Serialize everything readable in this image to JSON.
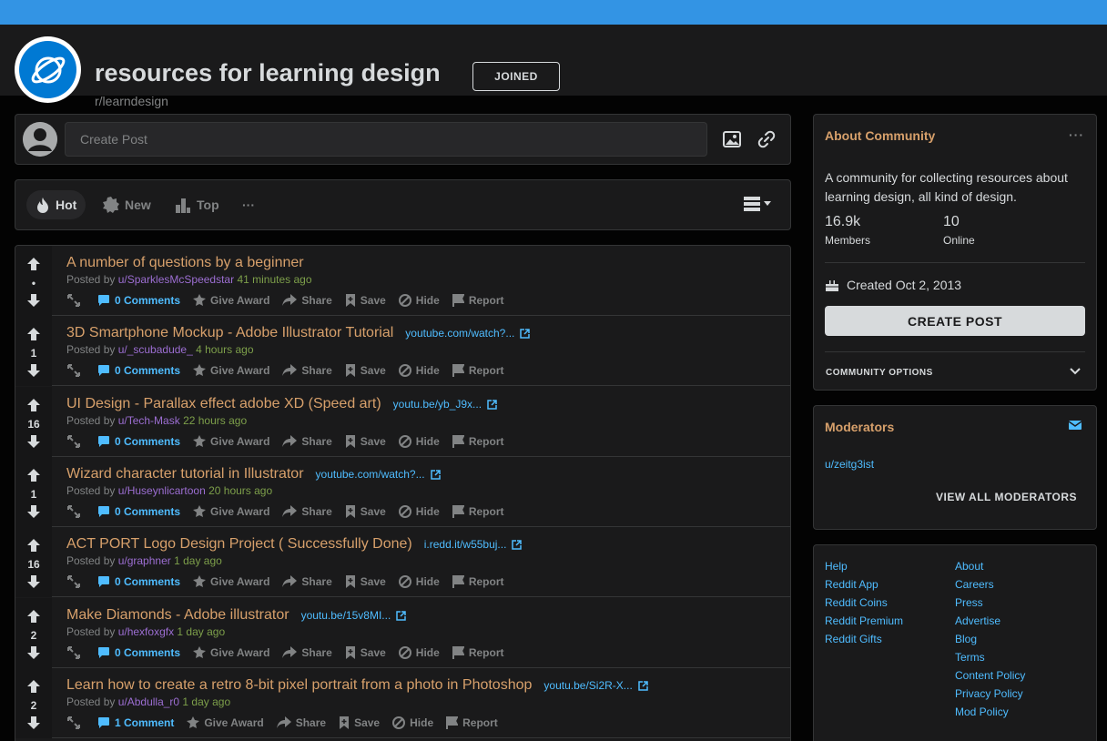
{
  "header": {
    "title": "resources for learning design",
    "subreddit": "r/learndesign",
    "joined_label": "JOINED"
  },
  "create_post": {
    "placeholder": "Create Post"
  },
  "sort": {
    "hot": "Hot",
    "new": "New",
    "top": "Top",
    "more": "···"
  },
  "posts": [
    {
      "title": "A number of questions by a beginner",
      "link": "",
      "votes": "•",
      "user": "u/SparklesMcSpeedstar",
      "time": "41 minutes ago",
      "comments": "0 Comments"
    },
    {
      "title": "3D Smartphone Mockup - Adobe Illustrator Tutorial",
      "link": "youtube.com/watch?...",
      "votes": "1",
      "user": "u/_scubadude_",
      "time": "4 hours ago",
      "comments": "0 Comments"
    },
    {
      "title": "UI Design - Parallax effect adobe XD (Speed art)",
      "link": "youtu.be/yb_J9x...",
      "votes": "16",
      "user": "u/Tech-Mask",
      "time": "22 hours ago",
      "comments": "0 Comments"
    },
    {
      "title": "Wizard character tutorial in Illustrator",
      "link": "youtube.com/watch?...",
      "votes": "1",
      "user": "u/Huseynlicartoon",
      "time": "20 hours ago",
      "comments": "0 Comments"
    },
    {
      "title": "ACT PORT Logo Design Project ( Successfully Done)",
      "link": "i.redd.it/w55buj...",
      "votes": "16",
      "user": "u/graphner",
      "time": "1 day ago",
      "comments": "0 Comments"
    },
    {
      "title": "Make Diamonds - Adobe illustrator",
      "link": "youtu.be/15v8MI...",
      "votes": "2",
      "user": "u/hexfoxgfx",
      "time": "1 day ago",
      "comments": "0 Comments"
    },
    {
      "title": "Learn how to create a retro 8-bit pixel portrait from a photo in Photoshop",
      "link": "youtu.be/Si2R-X...",
      "votes": "2",
      "user": "u/Abdulla_r0",
      "time": "1 day ago",
      "comments": "1 Comment"
    }
  ],
  "post_labels": {
    "posted_by": "Posted by",
    "give_award": "Give Award",
    "share": "Share",
    "save": "Save",
    "hide": "Hide",
    "report": "Report"
  },
  "about": {
    "heading": "About Community",
    "description": "A community for collecting resources about learning design, all kind of design.",
    "members_value": "16.9k",
    "members_label": "Members",
    "online_value": "10",
    "online_label": "Online",
    "created": "Created Oct 2, 2013",
    "create_post_label": "CREATE POST",
    "community_options": "COMMUNITY OPTIONS"
  },
  "moderators": {
    "heading": "Moderators",
    "users": [
      "u/zeitg3ist"
    ],
    "view_all": "VIEW ALL MODERATORS"
  },
  "footer": {
    "col1": [
      "Help",
      "Reddit App",
      "Reddit Coins",
      "Reddit Premium",
      "Reddit Gifts"
    ],
    "col2": [
      "About",
      "Careers",
      "Press",
      "Advertise",
      "Blog",
      "Terms",
      "Content Policy",
      "Privacy Policy",
      "Mod Policy"
    ]
  },
  "colors": {
    "banner": "#3394e4",
    "accent_title": "#d7a06b",
    "link": "#4fbcff",
    "username": "#9c6ed2",
    "time": "#7d9f4a"
  }
}
